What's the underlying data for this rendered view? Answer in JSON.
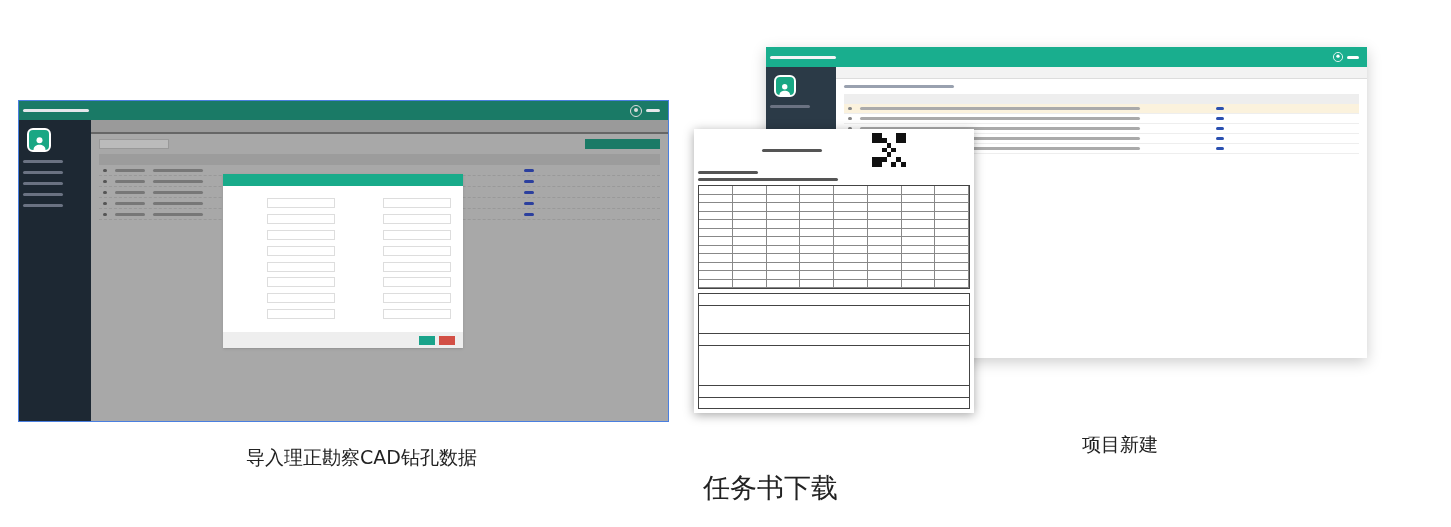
{
  "left_screenshot": {
    "caption": "导入理正勘察CAD钻孔数据"
  },
  "task_document": {
    "caption": "任务书下载"
  },
  "right_screenshot": {
    "caption": "项目新建"
  }
}
